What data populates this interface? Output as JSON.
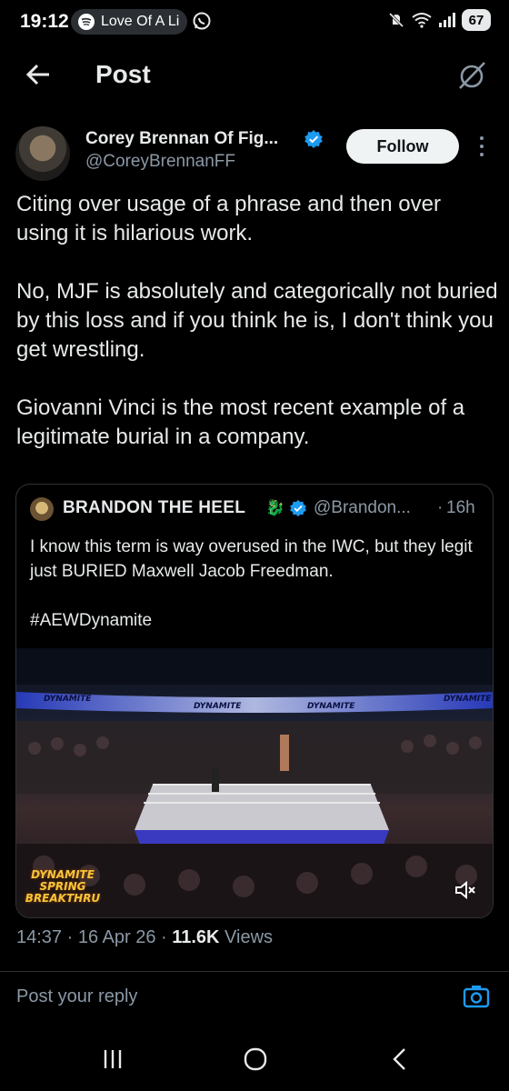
{
  "status_bar": {
    "time": "19:12",
    "now_playing": "Love Of A Li",
    "battery": "67"
  },
  "header": {
    "title": "Post"
  },
  "post": {
    "author_name": "Corey Brennan Of Fig...",
    "author_handle": "@CoreyBrennanFF",
    "follow_label": "Follow",
    "paragraphs": [
      "Citing over usage of a phrase and then over using it is hilarious work.",
      "No, MJF is absolutely and categorically not buried by this loss and if you think he is, I don't think you get wrestling.",
      "Giovanni Vinci is the most recent example of a legitimate burial in a company."
    ],
    "timestamp": "14:37 · 16 Apr 26 · ",
    "views_count": "11.6K",
    "views_label": " Views"
  },
  "quote": {
    "name": "BRANDON THE HEEL",
    "emoji": "🐉",
    "handle": "@Brandon...",
    "separator": "·",
    "time": "16h",
    "paragraphs": [
      "I know this term is way overused in the IWC, but they legit just BURIED Maxwell Jacob Freedman.",
      "#AEWDynamite"
    ],
    "media_banner_text": "DYNAMITE",
    "media_logo_text": "DYNAMITE",
    "media_event_text": "SPRING BREAKTHRU"
  },
  "reply": {
    "placeholder": "Post your reply"
  },
  "colors": {
    "background": "#000000",
    "text_primary": "#e7e9ea",
    "text_secondary": "#8b98a5",
    "verified_blue": "#1d9bf0",
    "border": "#2f3336",
    "follow_bg": "#eff3f4"
  }
}
